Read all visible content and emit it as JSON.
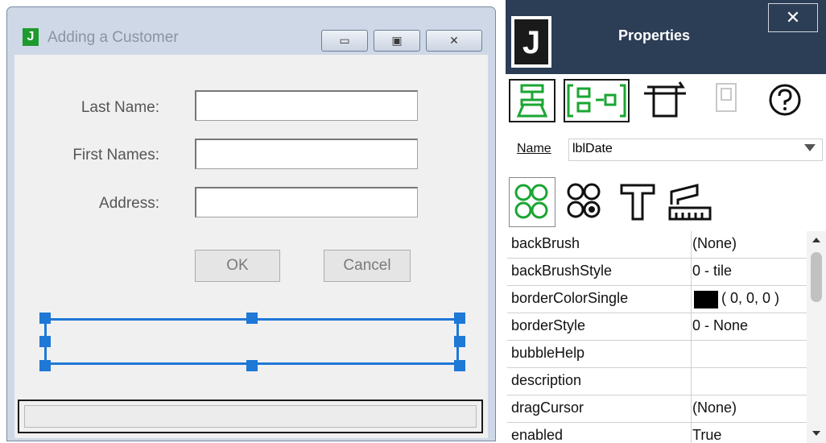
{
  "form_window": {
    "title": "Adding a Customer",
    "app_icon_letter": "J",
    "minimize_icon": "▭",
    "maximize_icon": "▣",
    "close_icon": "✕",
    "fields": [
      {
        "label": "Last Name:",
        "value": ""
      },
      {
        "label": "First Names:",
        "value": ""
      },
      {
        "label": "Address:",
        "value": ""
      }
    ],
    "ok_label": "OK",
    "cancel_label": "Cancel"
  },
  "properties_panel": {
    "title": "Properties",
    "logo_letter": "J",
    "close_icon": "✕",
    "toolbar_icons": [
      "pin-icon",
      "align-icon",
      "trash-icon",
      "copy-icon",
      "help-icon"
    ],
    "name_label": "Name",
    "name_value": "lblDate",
    "tab_icons": [
      "properties-tab-icon",
      "events-tab-icon",
      "text-tab-icon",
      "layout-tab-icon"
    ],
    "properties": [
      {
        "name": "backBrush",
        "value": "(None)"
      },
      {
        "name": "backBrushStyle",
        "value": "0 - tile"
      },
      {
        "name": "borderColorSingle",
        "value": "( 0, 0, 0 )",
        "swatch": "#000000"
      },
      {
        "name": "borderStyle",
        "value": "0 - None"
      },
      {
        "name": "bubbleHelp",
        "value": ""
      },
      {
        "name": "description",
        "value": ""
      },
      {
        "name": "dragCursor",
        "value": "(None)"
      },
      {
        "name": "enabled",
        "value": "True"
      }
    ]
  },
  "colors": {
    "selection": "#1e78d6",
    "panel_header": "#2c3e55",
    "icon_green": "#1aa632"
  }
}
